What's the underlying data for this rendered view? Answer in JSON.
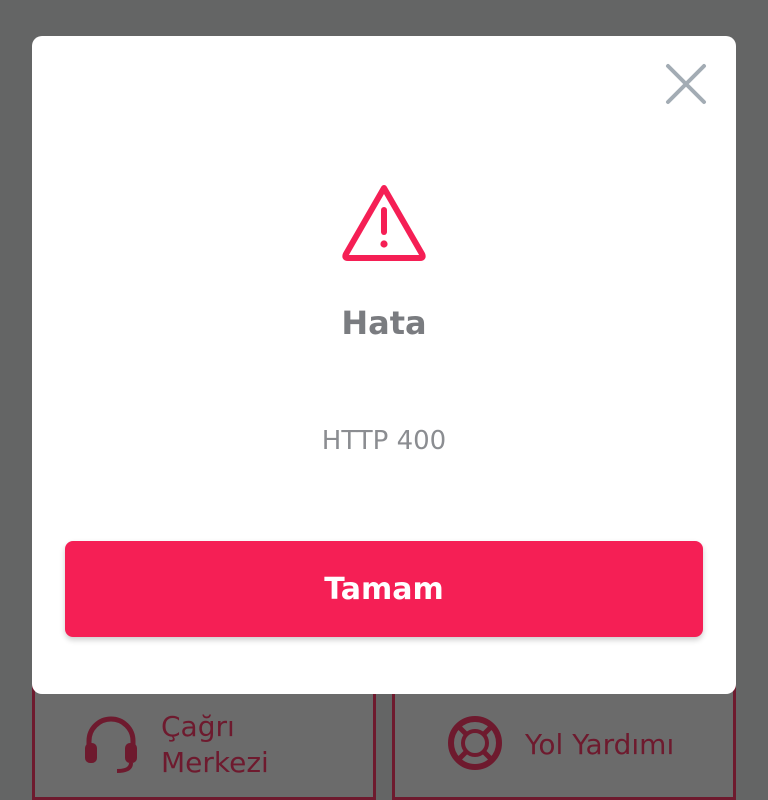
{
  "dialog": {
    "title": "Hata",
    "message": "HTTP 400",
    "ok_label": "Tamam",
    "icon": "warning-triangle-icon",
    "close_icon": "close-icon",
    "accent_color": "#f51f55"
  },
  "background": {
    "cards": [
      {
        "label": "Çağrı\nMerkezi",
        "icon": "headset-icon"
      },
      {
        "label": "Yol Yardımı",
        "icon": "lifebuoy-icon"
      }
    ]
  }
}
